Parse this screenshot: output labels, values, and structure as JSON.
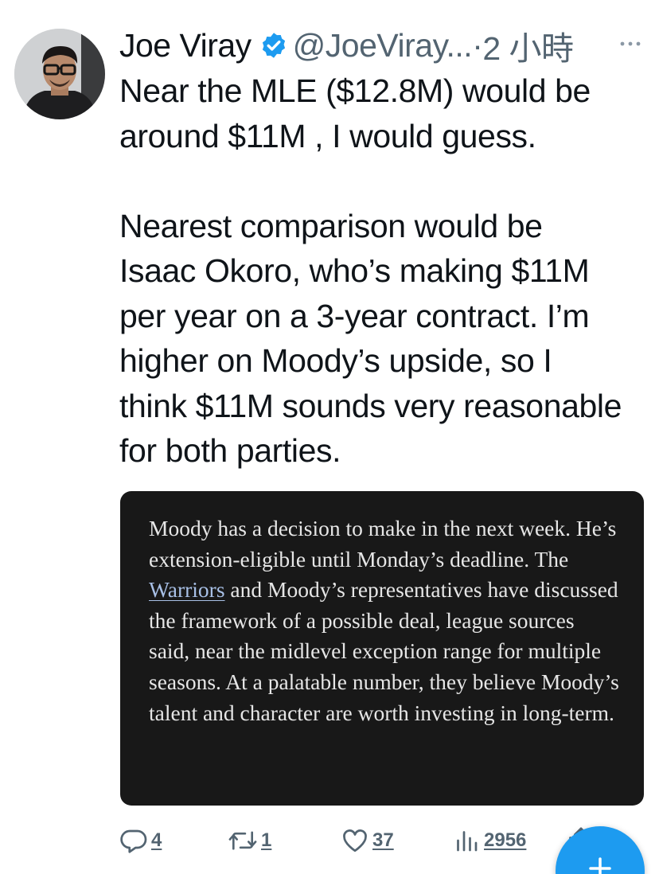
{
  "tweet": {
    "author_name": "Joe Viray",
    "handle": "@JoeViray...",
    "separator": "·",
    "time": "2 小時",
    "text": "Near the MLE ($12.8M) would be\naround $11M , I would guess.\n\nNearest comparison would be\nIsaac Okoro, who’s making $11M\nper year on a 3-year contract. I’m\nhigher on Moody’s upside, so I\nthink $11M sounds very reasonable\nfor both parties."
  },
  "quote": {
    "text_before": "Moody has a decision to make in the next week. He’s extension-eligible until Monday’s deadline. The ",
    "link_text": "Warriors",
    "text_after": " and Moody’s representatives have discussed the framework of a possible deal, league sources said, near the midlevel exception range for multiple seasons. At a palatable number, they believe Moody’s talent and character are worth investing in long-term."
  },
  "actions": {
    "replies": "4",
    "retweets": "1",
    "likes": "37",
    "views": "2956"
  },
  "icons": {
    "verified": "verified-badge-icon",
    "more": "more-icon",
    "reply": "reply-icon",
    "retweet": "retweet-icon",
    "like": "heart-icon",
    "views": "views-icon",
    "share": "share-icon",
    "compose": "plus-icon"
  },
  "colors": {
    "accent": "#1d9bf0",
    "secondary_text": "#536471",
    "quote_background": "#181818"
  }
}
